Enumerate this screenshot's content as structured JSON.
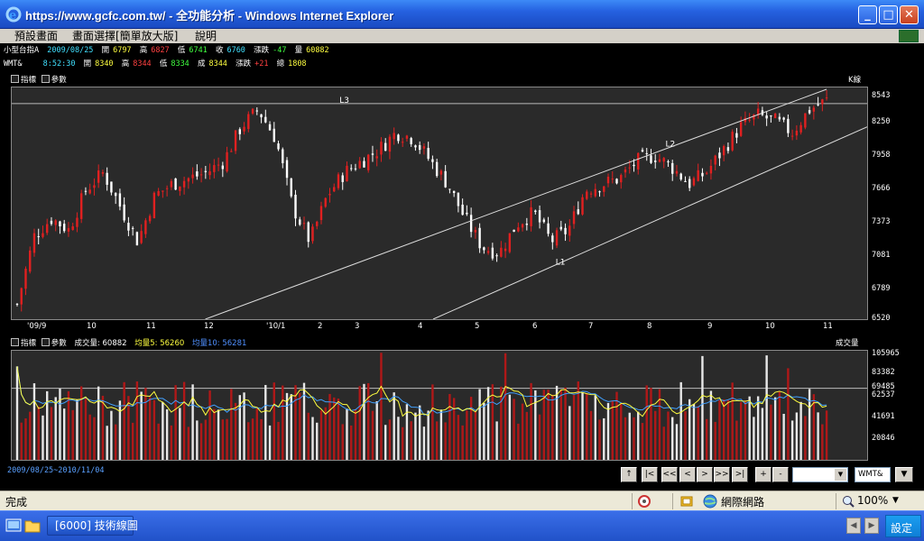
{
  "window": {
    "title": "https://www.gcfc.com.tw/ - 全功能分析 - Windows Internet Explorer",
    "min_label": "_",
    "max_label": "□",
    "close_label": "✕"
  },
  "menu": {
    "items": [
      "預設畫面",
      "畫面選擇[簡單放大版]",
      "說明"
    ]
  },
  "info1": {
    "name": "小型台指A",
    "date": "2009/08/25",
    "open_label": "開",
    "open": "6797",
    "high_label": "高",
    "high": "6827",
    "low_label": "低",
    "low": "6741",
    "close_label": "收",
    "close": "6760",
    "chg_label": "漲跌",
    "chg": "-47",
    "vol_label": "量",
    "vol": "60882"
  },
  "info2": {
    "name": "WMT&",
    "time": "8:52:30",
    "open_label": "開",
    "open": "8340",
    "high_label": "高",
    "high": "8344",
    "low_label": "低",
    "low": "8334",
    "deal_label": "成",
    "deal": "8344",
    "chg_label": "漲跌",
    "chg": "+21",
    "total_label": "總",
    "total": "1808"
  },
  "main_panel": {
    "indicator_label": "指標",
    "param_label": "參數",
    "kline_label": "K線"
  },
  "vol_panel": {
    "indicator_label": "指標",
    "param_label": "參數",
    "vol_text": "成交量: 60882",
    "ma5_text": "均量5: 56260",
    "ma10_text": "均量10: 56281",
    "unit_label": "成交量"
  },
  "chart_data": [
    {
      "type": "candlestick",
      "y_ticks": [
        "8543",
        "8250",
        "7958",
        "7666",
        "7373",
        "7081",
        "6789",
        "6520"
      ],
      "x_ticks": [
        "'09/9",
        "10",
        "11",
        "12",
        "'10/1",
        "2",
        "3",
        "4",
        "5",
        "6",
        "7",
        "8",
        "9",
        "10",
        "11"
      ],
      "ylim": [
        6520,
        8543
      ],
      "trendline_labels": [
        "L1",
        "L2",
        "L3"
      ],
      "approx_close_path": [
        6650,
        7250,
        7400,
        7300,
        7650,
        7800,
        7500,
        7200,
        7600,
        7700,
        7750,
        7800,
        7900,
        8200,
        8350,
        8100,
        7500,
        7200,
        7600,
        7800,
        7900,
        8000,
        8150,
        8100,
        7900,
        7700,
        7400,
        7150,
        7100,
        7350,
        7450,
        7200,
        7300,
        7650,
        7700,
        7750,
        7900,
        7950,
        7850,
        7700,
        7800,
        8000,
        8200,
        8300,
        8250,
        8150,
        8350,
        8430
      ]
    },
    {
      "type": "bar",
      "y_ticks": [
        "105965",
        "83382",
        "69485",
        "62537",
        "41691",
        "20846"
      ],
      "ylim": [
        0,
        105965
      ],
      "series": [
        {
          "name": "成交量"
        },
        {
          "name": "均量5"
        },
        {
          "name": "均量10"
        }
      ]
    }
  ],
  "bottom": {
    "range": "2009/08/25~2010/11/04",
    "buttons": [
      "↑",
      "|<",
      "<<",
      "<",
      ">",
      ">>",
      ">|",
      "+",
      "-"
    ],
    "symbol_value": "WMT&",
    "dropdown_arrow": "▼"
  },
  "status": {
    "done": "完成",
    "zone": "網際網路",
    "zoom": "100%"
  },
  "taskbar": {
    "task": "[6000] 技術線圖",
    "settings": "設定"
  },
  "colors": {
    "up": "#e02020",
    "down": "#ffffff",
    "ma5": "#ffff40",
    "ma10": "#40a0ff",
    "panel_bg": "#2a2a2a"
  }
}
